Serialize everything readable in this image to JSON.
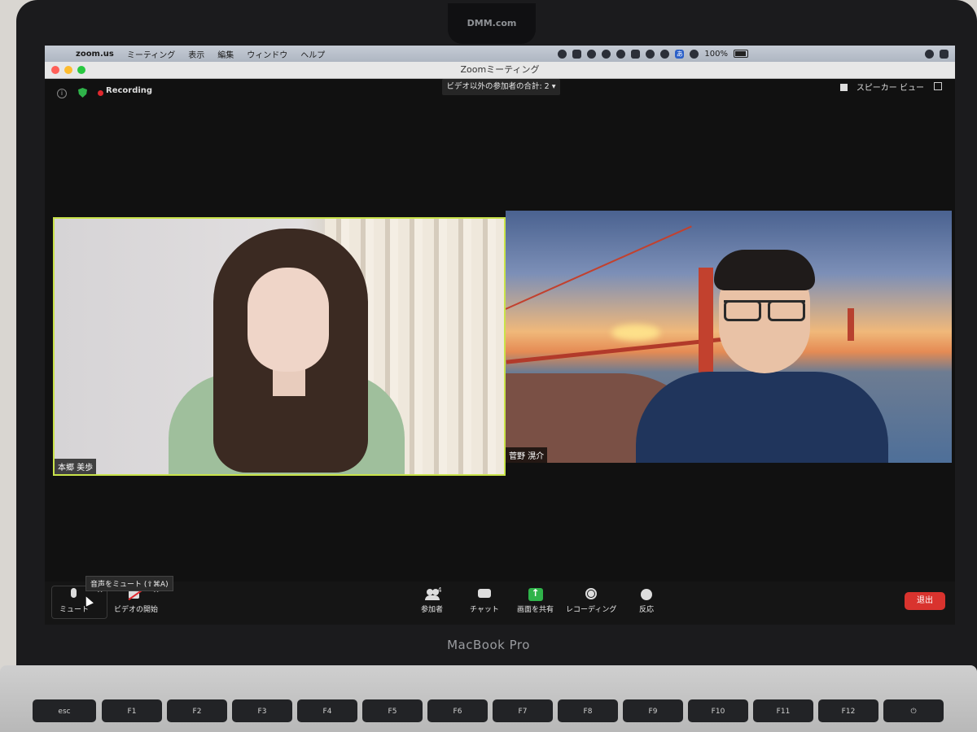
{
  "laptop": {
    "camera_label": "DMM.com",
    "brand": "MacBook Pro"
  },
  "menubar": {
    "items": [
      "zoom.us",
      "ミーティング",
      "表示",
      "編集",
      "ウィンドウ",
      "ヘルプ"
    ],
    "battery": "100%"
  },
  "window": {
    "title": "Zoomミーティング"
  },
  "meeting": {
    "recording_label": "Recording",
    "participants_dropdown": "ビデオ以外の参加者の合計: 2",
    "view_label": "スピーカー ビュー"
  },
  "tiles": [
    {
      "name": "本郷 美歩",
      "active_speaker": true
    },
    {
      "name": "菅野 滉介",
      "active_speaker": false
    }
  ],
  "toolbar": {
    "tooltip": "音声をミュート (⇧⌘A)",
    "mute_label": "ミュート",
    "video_label": "ビデオの開始",
    "participants_label": "参加者",
    "participants_count": "4",
    "chat_label": "チャット",
    "share_label": "画面を共有",
    "record_label": "レコーディング",
    "reactions_label": "反応",
    "end_label": "退出"
  },
  "keyboard": {
    "keys": [
      "esc",
      "F1",
      "F2",
      "F3",
      "F4",
      "F5",
      "F6",
      "F7",
      "F8",
      "F9",
      "F10",
      "F11",
      "F12"
    ]
  },
  "colors": {
    "active_speaker_border": "#c9e34a",
    "end_button": "#d9332e",
    "share_green": "#2fb34a",
    "recording_red": "#e0282e"
  }
}
